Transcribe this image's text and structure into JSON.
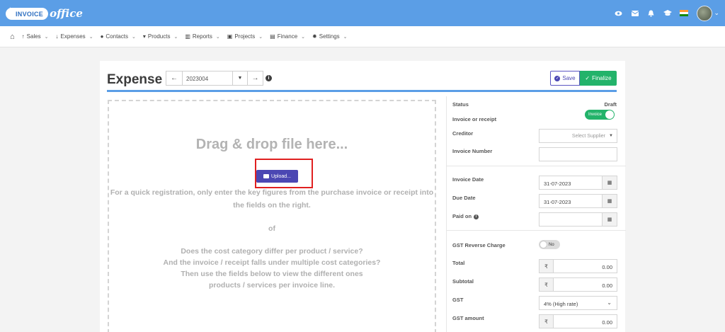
{
  "brand": {
    "logo_text": "INVOICE",
    "logo_script": "office"
  },
  "topbar": {
    "icons": [
      "eye-icon",
      "envelope-icon",
      "bell-icon",
      "graduation-cap-icon"
    ],
    "flag_colors": [
      "#ff9933",
      "#ffffff",
      "#138808"
    ]
  },
  "menu": {
    "home_icon": "home-icon",
    "items": [
      {
        "label": "Sales",
        "icon": "arrow-up-icon"
      },
      {
        "label": "Expenses",
        "icon": "arrow-down-icon"
      },
      {
        "label": "Contacts",
        "icon": "user-icon"
      },
      {
        "label": "Products",
        "icon": "cart-icon"
      },
      {
        "label": "Reports",
        "icon": "chart-icon"
      },
      {
        "label": "Projects",
        "icon": "briefcase-icon"
      },
      {
        "label": "Finance",
        "icon": "money-icon"
      },
      {
        "label": "Settings",
        "icon": "gear-icon"
      }
    ]
  },
  "page": {
    "title": "Expense",
    "doc_number": "2023004",
    "save_label": "Save",
    "finalize_label": "Finalize"
  },
  "dropzone": {
    "title": "Drag & drop file here...",
    "upload_label": "Upload...",
    "line1": "For a quick registration, only enter the key figures from the purchase invoice or receipt into",
    "line2": "the fields on the right.",
    "or": "of",
    "line3": "Does the cost category differ per product / service?",
    "line4": "And the invoice / receipt falls under multiple cost categories?",
    "line5": "Then use the fields below to view the different ones",
    "line6": "products / services per invoice line."
  },
  "form": {
    "status_label": "Status",
    "status_value": "Draft",
    "invoice_or_receipt_label": "Invoice or receipt",
    "invoice_toggle": "Invoice",
    "creditor_label": "Creditor",
    "creditor_placeholder": "Select Supplier",
    "invoice_number_label": "Invoice Number",
    "invoice_number_value": "",
    "invoice_date_label": "Invoice Date",
    "invoice_date_value": "31-07-2023",
    "due_date_label": "Due Date",
    "due_date_value": "31-07-2023",
    "paid_on_label": "Paid on",
    "paid_on_value": "",
    "gst_reverse_label": "GST Reverse Charge",
    "gst_reverse_value": "No",
    "currency_symbol": "₹",
    "total_label": "Total",
    "total_value": "0.00",
    "subtotal_label": "Subtotal",
    "subtotal_value": "0.00",
    "gst_label": "GST",
    "gst_value": "4% (High rate)",
    "gst_amount_label": "GST amount",
    "gst_amount_value": "0.00"
  },
  "colors": {
    "topbar": "#5b9ee6",
    "primary": "#4b47b3",
    "success": "#23b36a",
    "highlight": "#e02020"
  }
}
